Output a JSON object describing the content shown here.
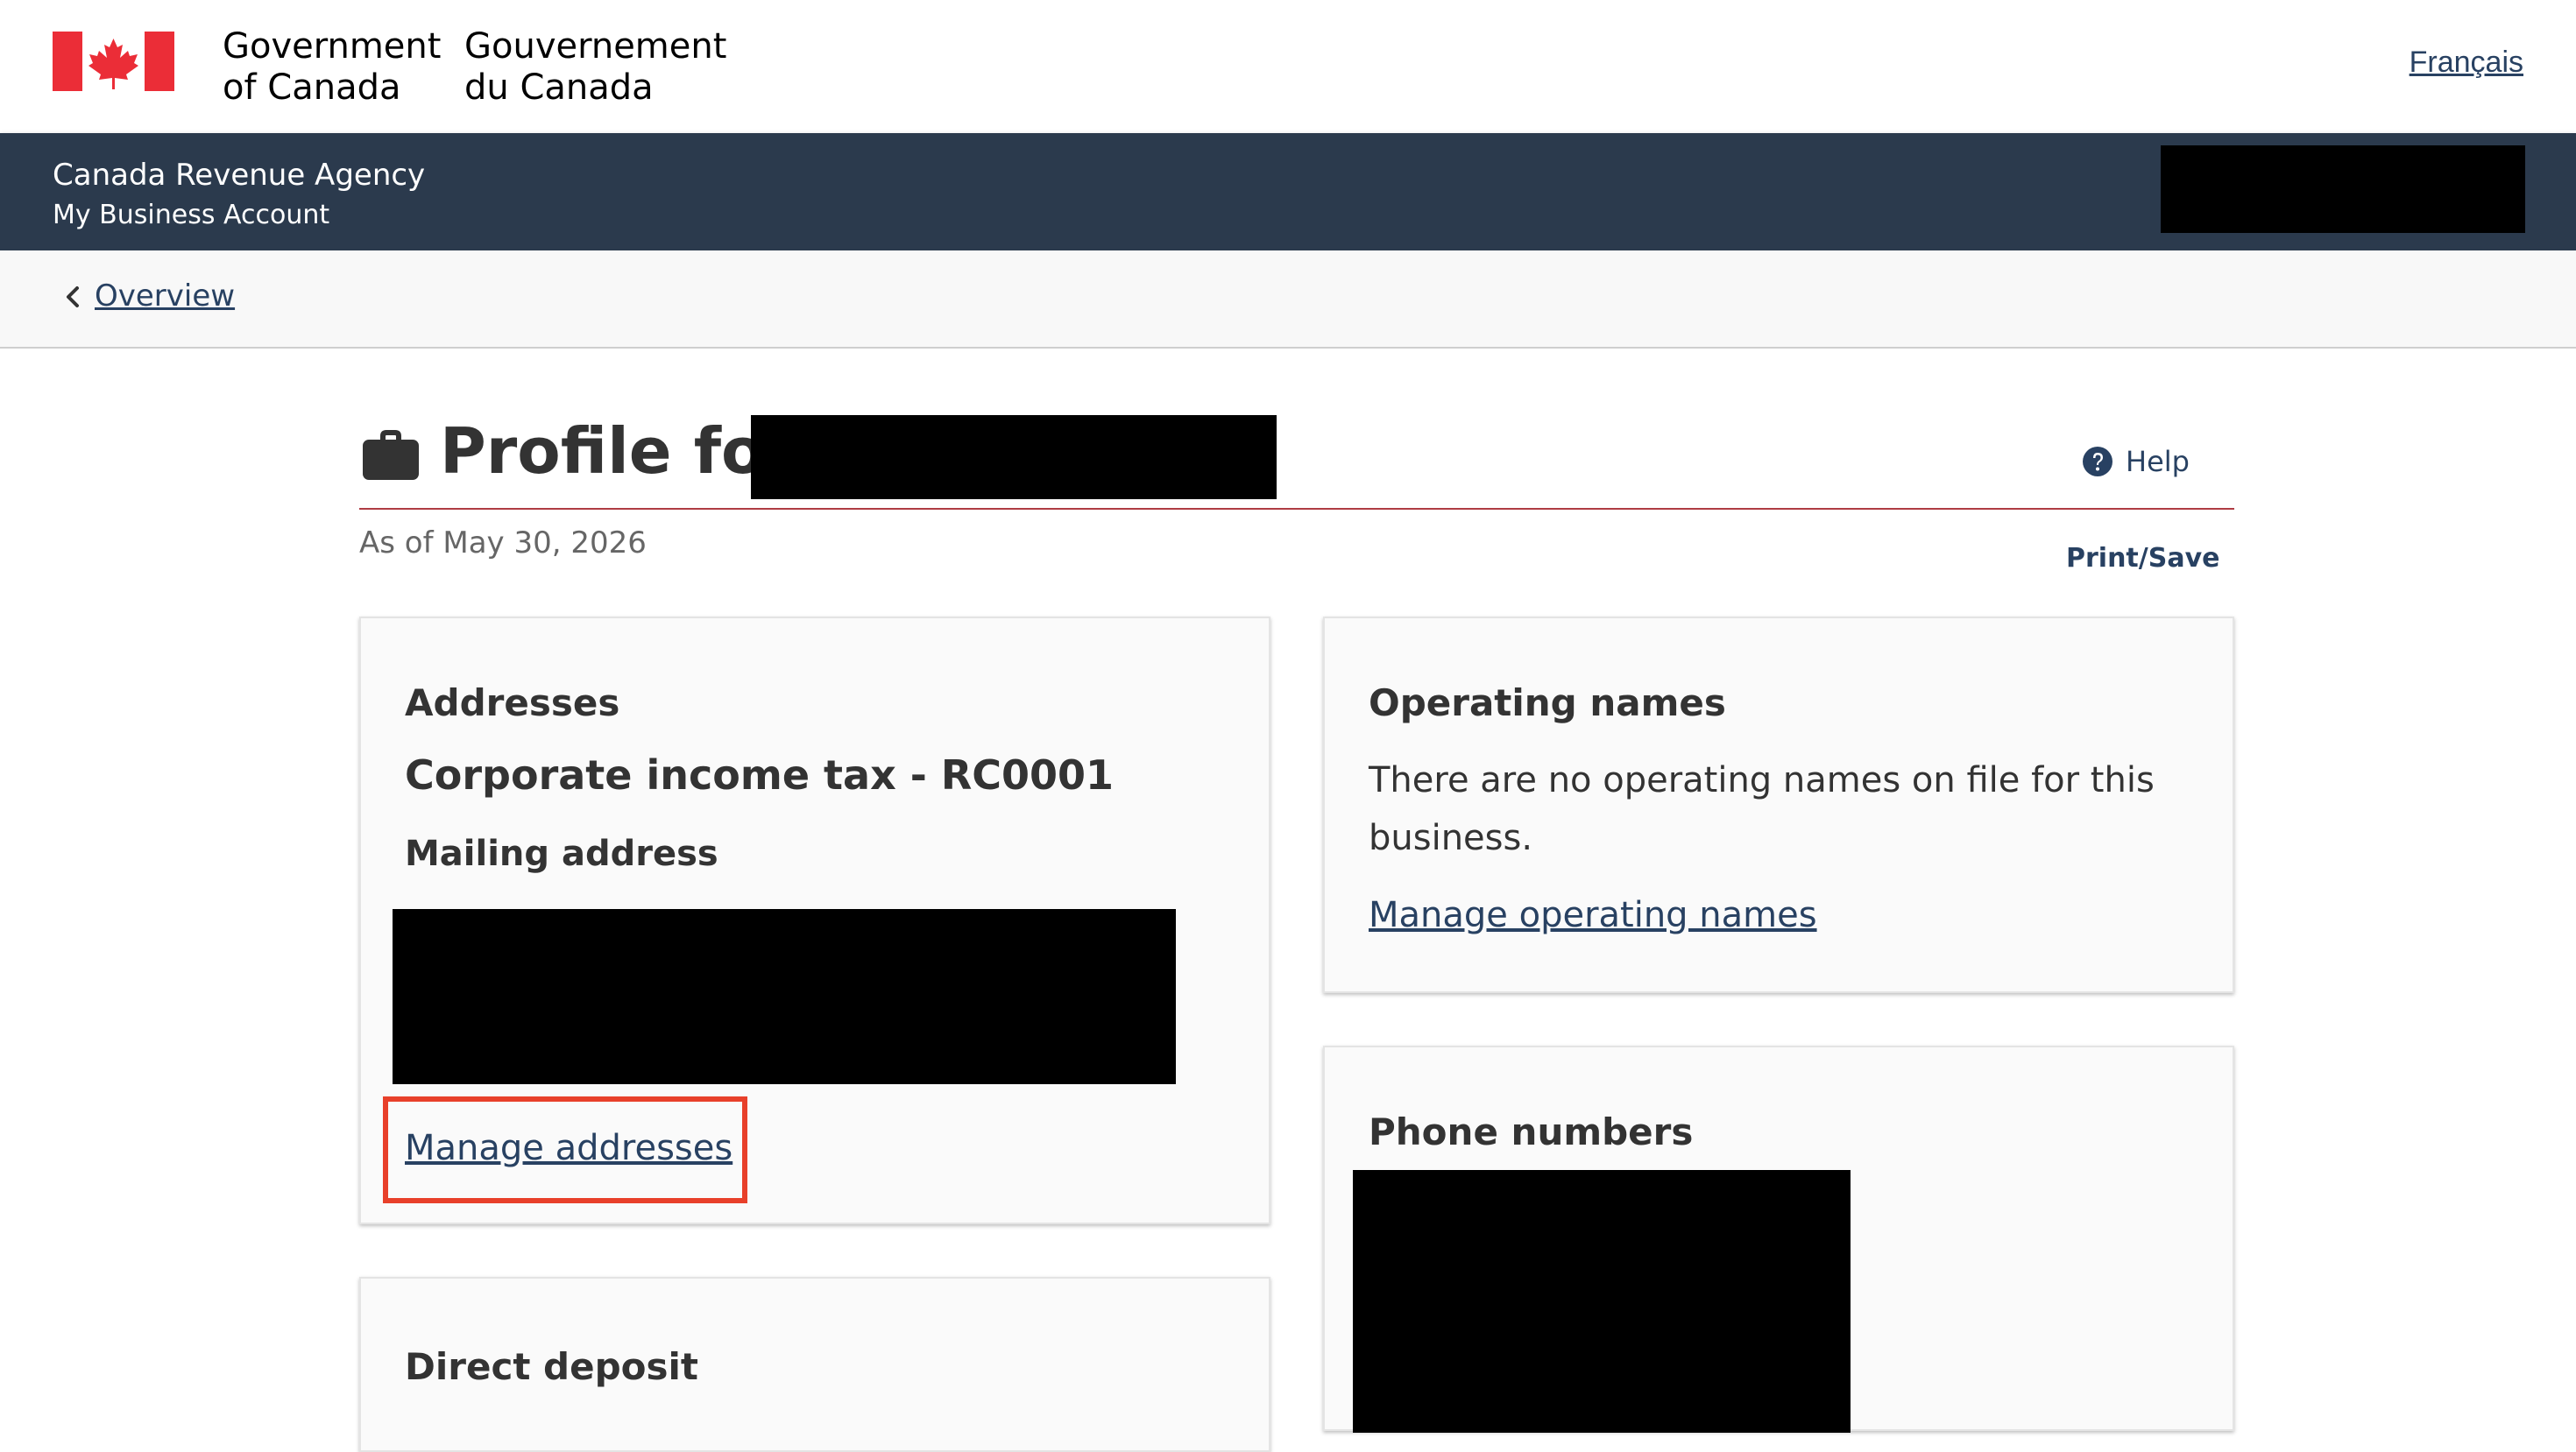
{
  "header": {
    "signature_en": "Government\nof Canada",
    "signature_fr": "Gouvernement\ndu Canada",
    "language_toggle": "Français",
    "flag_icon": "canada-flag-icon",
    "flag_color": "#eb2d37"
  },
  "app_bar": {
    "agency": "Canada Revenue Agency",
    "account": "My Business Account",
    "background": "#2b3a4d"
  },
  "breadcrumb": {
    "link": "Overview",
    "icon": "chevron-left-icon"
  },
  "page": {
    "title": "Profile for",
    "title_icon": "briefcase-icon",
    "help_label": "Help",
    "help_icon": "question-circle-icon",
    "as_of": "As of May 30, 2026",
    "print_save": "Print/Save",
    "accent_rule_color": "#af3c43"
  },
  "cards": {
    "addresses": {
      "heading": "Addresses",
      "program": "Corporate income tax - RC0001",
      "subheading": "Mailing address",
      "link": "Manage addresses"
    },
    "operating_names": {
      "heading": "Operating names",
      "body": "There are no operating names on file for this business.",
      "link": "Manage operating names"
    },
    "phone_numbers": {
      "heading": "Phone numbers"
    },
    "direct_deposit": {
      "heading": "Direct deposit"
    }
  },
  "colors": {
    "link": "#284162",
    "highlight": "#e8402a"
  }
}
